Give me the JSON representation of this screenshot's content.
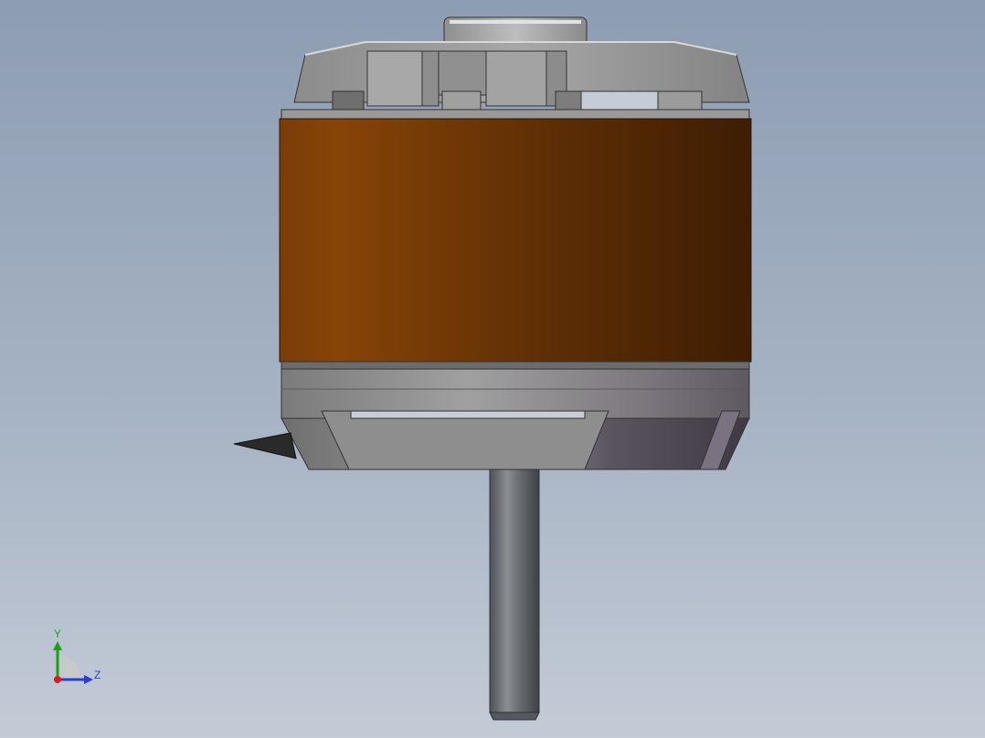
{
  "viewport": {
    "background_top": "#8d9db2",
    "background_bottom": "#c3cbd6"
  },
  "model": {
    "name": "brushless-outrunner-motor",
    "can_color": "#7e3f07",
    "metal_color": "#9a9a9a",
    "shaft_color": "#6b6e73"
  },
  "triad": {
    "y_label": "Y",
    "z_label": "Z",
    "y_color": "#19a119",
    "z_color": "#2a3fd0",
    "x_color": "#d02020"
  }
}
